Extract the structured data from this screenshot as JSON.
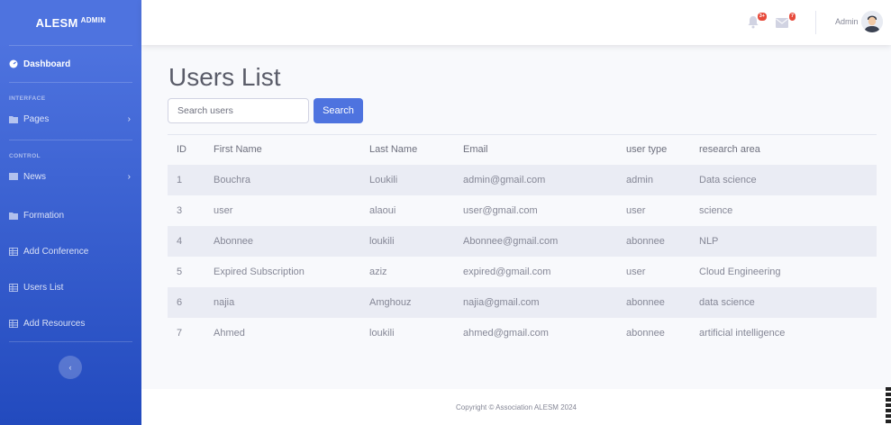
{
  "brand": {
    "name": "ALESM",
    "suffix": "ADMIN"
  },
  "sidebar": {
    "dashboard": "Dashboard",
    "heading_interface": "INTERFACE",
    "pages": "Pages",
    "heading_control": "CONTROL",
    "news": "News",
    "formation": "Formation",
    "add_conference": "Add Conference",
    "users_list": "Users List",
    "add_resources": "Add Resources"
  },
  "topbar": {
    "alerts_badge": "3+",
    "messages_badge": "7",
    "user_name": "Admin"
  },
  "main": {
    "title": "Users List",
    "search_placeholder": "Search users",
    "search_button": "Search"
  },
  "table": {
    "headers": [
      "ID",
      "First Name",
      "Last Name",
      "Email",
      "user type",
      "research area"
    ],
    "rows": [
      [
        "1",
        "Bouchra",
        "Loukili",
        "admin@gmail.com",
        "admin",
        "Data science"
      ],
      [
        "3",
        "user",
        "alaoui",
        "user@gmail.com",
        "user",
        "science"
      ],
      [
        "4",
        "Abonnee",
        "loukili",
        "Abonnee@gmail.com",
        "abonnee",
        "NLP"
      ],
      [
        "5",
        "Expired Subscription",
        "aziz",
        "expired@gmail.com",
        "user",
        "Cloud Engineering"
      ],
      [
        "6",
        "najia",
        "Amghouz",
        "najia@gmail.com",
        "abonnee",
        "data science"
      ],
      [
        "7",
        "Ahmed",
        "loukili",
        "ahmed@gmail.com",
        "abonnee",
        "artificial intelligence"
      ]
    ]
  },
  "footer": {
    "copyright": "Copyright © Association ALESM 2024"
  },
  "colors": {
    "primary": "#4e73df",
    "sidebar_dark": "#224abe",
    "danger": "#e74a3b"
  }
}
